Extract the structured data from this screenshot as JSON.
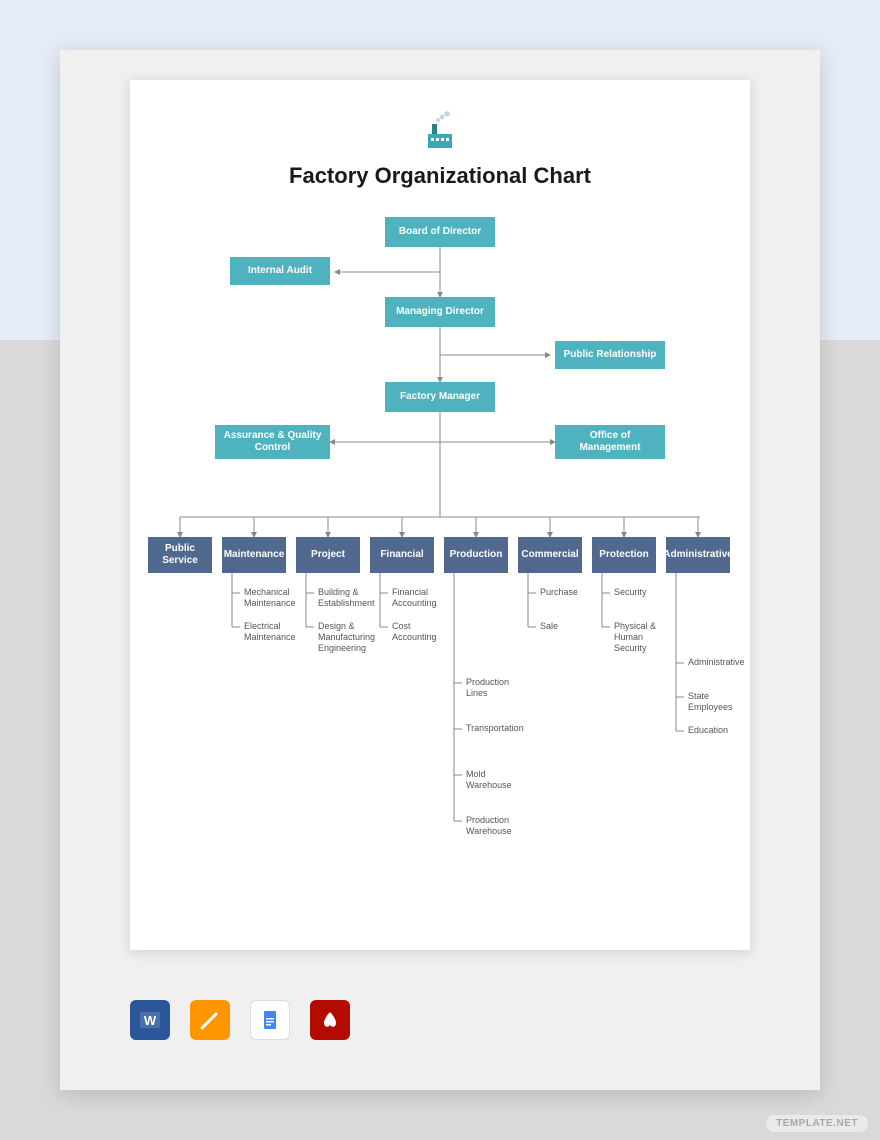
{
  "title": "Factory Organizational Chart",
  "watermark": "TEMPLATE.NET",
  "nodes": {
    "board": "Board of Director",
    "audit": "Internal Audit",
    "md": "Managing Director",
    "pr": "Public Relationship",
    "fm": "Factory Manager",
    "aqc": "Assurance & Quality Control",
    "om": "Office of Management"
  },
  "departments": [
    {
      "name": "Public Service",
      "subs": []
    },
    {
      "name": "Maintenance",
      "subs": [
        "Mechanical Maintenance",
        "Electrical Maintenance"
      ]
    },
    {
      "name": "Project",
      "subs": [
        "Building & Establishment",
        "Design & Manufacturing Engineering"
      ]
    },
    {
      "name": "Financial",
      "subs": [
        "Financial Accounting",
        "Cost Accounting"
      ]
    },
    {
      "name": "Production",
      "subs": [
        "Production Lines",
        "Transportation",
        "Mold Warehouse",
        "Production Warehouse"
      ]
    },
    {
      "name": "Commercial",
      "subs": [
        "Purchase",
        "Sale"
      ]
    },
    {
      "name": "Protection",
      "subs": [
        "Security",
        "Physical & Human Security"
      ]
    },
    {
      "name": "Administrative",
      "subs": [
        "Administrative",
        "State Employees",
        "Education"
      ]
    }
  ],
  "apps": [
    "Word",
    "Pages",
    "Google Docs",
    "PDF"
  ]
}
